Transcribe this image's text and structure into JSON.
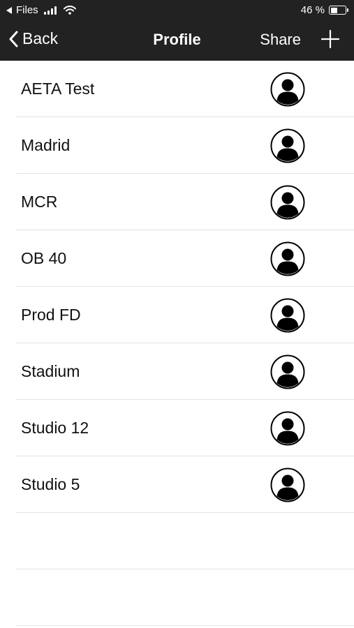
{
  "status_bar": {
    "back_app": "Files",
    "battery": "46 %",
    "battery_level": 0.46
  },
  "nav": {
    "back_label": "Back",
    "title": "Profile",
    "share_label": "Share",
    "add_icon": "plus-icon"
  },
  "profiles": [
    {
      "name": "AETA Test",
      "icon": "avatar-icon"
    },
    {
      "name": "Madrid",
      "icon": "avatar-icon"
    },
    {
      "name": "MCR",
      "icon": "avatar-icon"
    },
    {
      "name": "OB 40",
      "icon": "avatar-icon"
    },
    {
      "name": "Prod FD",
      "icon": "avatar-icon"
    },
    {
      "name": "Stadium",
      "icon": "avatar-icon"
    },
    {
      "name": "Studio 12",
      "icon": "avatar-icon"
    },
    {
      "name": "Studio 5",
      "icon": "avatar-icon"
    }
  ],
  "colors": {
    "header_bg": "#222222",
    "header_text": "#ffffff",
    "divider": "#e3e3e3"
  }
}
